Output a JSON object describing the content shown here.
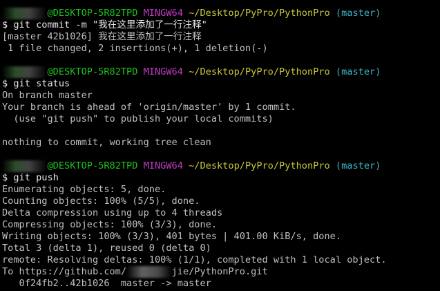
{
  "colors": {
    "background": "#000000",
    "text": "#c0c0c0",
    "user_host": "#1cc21c",
    "mingw": "#c13ac1",
    "path": "#c8c83a",
    "branch": "#3ab5c8"
  },
  "blocks": [
    {
      "prompt": {
        "host": "@DESKTOP-5R82TPD",
        "system": "MINGW64",
        "path": "~/Desktop/PyPro/PythonPro",
        "branch": "(master)"
      },
      "command": "$ git commit -m \"我在这里添加了一行注释\"",
      "output": [
        "[master 42b1026] 我在这里添加了一行注释",
        " 1 file changed, 2 insertions(+), 1 deletion(-)"
      ]
    },
    {
      "prompt": {
        "host": "@DESKTOP-5R82TPD",
        "system": "MINGW64",
        "path": "~/Desktop/PyPro/PythonPro",
        "branch": "(master)"
      },
      "command": "$ git status",
      "output": [
        "On branch master",
        "Your branch is ahead of 'origin/master' by 1 commit.",
        "  (use \"git push\" to publish your local commits)",
        "",
        "nothing to commit, working tree clean"
      ]
    },
    {
      "prompt": {
        "host": "@DESKTOP-5R82TPD",
        "system": "MINGW64",
        "path": "~/Desktop/PyPro/PythonPro",
        "branch": "(master)"
      },
      "command": "$ git push",
      "output": [
        "Enumerating objects: 5, done.",
        "Counting objects: 100% (5/5), done.",
        "Delta compression using up to 4 threads",
        "Compressing objects: 100% (3/3), done.",
        "Writing objects: 100% (3/3), 401 bytes | 401.00 KiB/s, done.",
        "Total 3 (delta 1), reused 0 (delta 0)",
        "remote: Resolving deltas: 100% (1/1), completed with 1 local object."
      ],
      "url_prefix": "To https://github.com/",
      "url_suffix": "jie/PythonPro.git",
      "push_result": "   0f24fb2..42b1026  master -> master"
    }
  ]
}
